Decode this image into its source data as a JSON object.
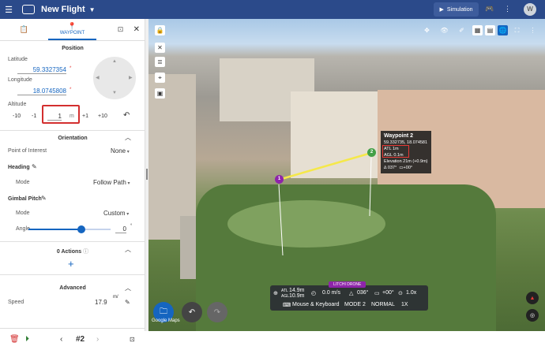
{
  "header": {
    "title": "New Flight",
    "simulation_label": "Simulation",
    "avatar_initial": "W"
  },
  "panel": {
    "tab_waypoint": "WAYPOINT",
    "position": {
      "title": "Position",
      "latitude_label": "Latitude",
      "latitude_value": "59.3327354",
      "longitude_label": "Longitude",
      "longitude_value": "18.0745808",
      "altitude_label": "Altitude",
      "altitude_value": "1",
      "altitude_unit": "m",
      "steps": [
        "-10",
        "-1",
        "+1",
        "+10"
      ]
    },
    "orientation": {
      "title": "Orientation",
      "poi_label": "Point of Interest",
      "poi_value": "None",
      "heading_label": "Heading",
      "heading_mode_label": "Mode",
      "heading_mode_value": "Follow Path",
      "gimbal_label": "Gimbal Pitch",
      "gimbal_mode_label": "Mode",
      "gimbal_mode_value": "Custom",
      "angle_label": "Angle",
      "angle_value": "0",
      "angle_unit": "°",
      "angle_fraction": 0.64
    },
    "actions": {
      "title": "0 Actions",
      "add": "+"
    },
    "advanced": {
      "title": "Advanced",
      "speed_label": "Speed",
      "speed_value": "17.9",
      "speed_unit": "m/"
    },
    "bottom": {
      "waypoint_index": "#2"
    }
  },
  "map": {
    "tooltip": {
      "title": "Waypoint 2",
      "coords": "59.332735, 18.074581",
      "atl": "ATL 1m",
      "agl": "AGL 0.1m",
      "elevation": "Elevation 21m (+0.9m)",
      "angles_a": "∆ 037°",
      "angles_b": "+00°"
    },
    "markers": [
      "1",
      "2"
    ],
    "hud": {
      "brand": "LITCHI DRONE",
      "atl_value": "14.9m",
      "agl_value": "10.9m",
      "atl_label": "ATL",
      "agl_label": "AGL",
      "speed": "0.0 m/s",
      "heading": "036°",
      "gimbal": "+00°",
      "zoom": "1.0x",
      "controls": "Mouse & Keyboard",
      "mode": "MODE 2",
      "speed_mode": "NORMAL",
      "mult": "1X"
    },
    "attribution": "Google Maps"
  },
  "colors": {
    "header": "#2b4a8a",
    "accent": "#1565c0",
    "highlight": "#d32f2f",
    "marker_purple": "#8e24aa",
    "marker_green": "#43a047"
  }
}
